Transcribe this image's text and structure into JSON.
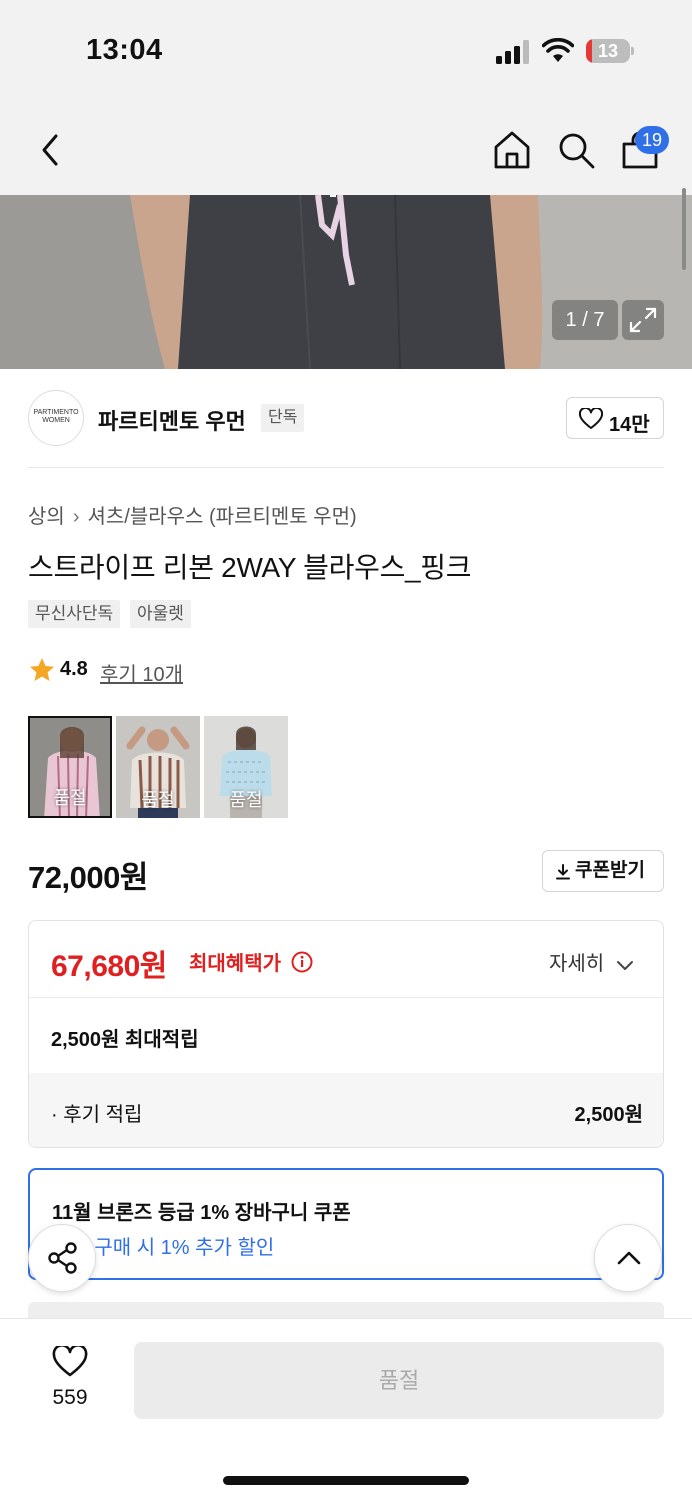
{
  "status": {
    "time": "13:04",
    "battery_level": "13",
    "battery_fraction": 0.13
  },
  "nav": {
    "back_icon": "chevron-left-icon",
    "home_icon": "home-icon",
    "search_icon": "search-icon",
    "cart_icon": "cart-icon",
    "cart_count": "19"
  },
  "gallery": {
    "counter": "1 / 7",
    "expand_icon": "expand-icon",
    "current": 1,
    "total": 7
  },
  "brand": {
    "logo_text": "PARTIMENTO WOMEN",
    "name": "파르티멘토 우먼",
    "tag": "단독",
    "like_count": "14만",
    "like_icon": "heart-outline-icon"
  },
  "product": {
    "breadcrumb": [
      "상의",
      "셔츠/블라우스",
      "(파르티멘토 우먼)"
    ],
    "title": "스트라이프 리본 2WAY 블라우스_핑크",
    "tags": [
      "무신사단독",
      "아울렛"
    ],
    "rating": "4.8",
    "review_link": "후기 10개",
    "star_color": "#f5a623",
    "options": [
      {
        "label": "품절",
        "color": "pink-stripe"
      },
      {
        "label": "품절",
        "color": "brown-stripe"
      },
      {
        "label": "품절",
        "color": "sky-blue"
      }
    ],
    "price": "72,000원",
    "coupon_button": "쿠폰받기"
  },
  "benefits": {
    "max_price": "67,680원",
    "max_label": "최대혜택가",
    "detail_toggle": "자세히",
    "points": "2,500원 최대적립",
    "review_label": "· 후기 적립",
    "review_amount": "2,500원",
    "accent": "#e02020"
  },
  "coupon": {
    "title": "11월 브론즈 등급 1% 장바구니 쿠폰",
    "subtitle": "이상 구매 시 1% 추가 할인",
    "accent": "#2f6fe8"
  },
  "floating": {
    "share_icon": "share-icon",
    "scroll_top_icon": "chevron-up-icon"
  },
  "bottom": {
    "like_count": "559",
    "soldout_label": "품절"
  }
}
